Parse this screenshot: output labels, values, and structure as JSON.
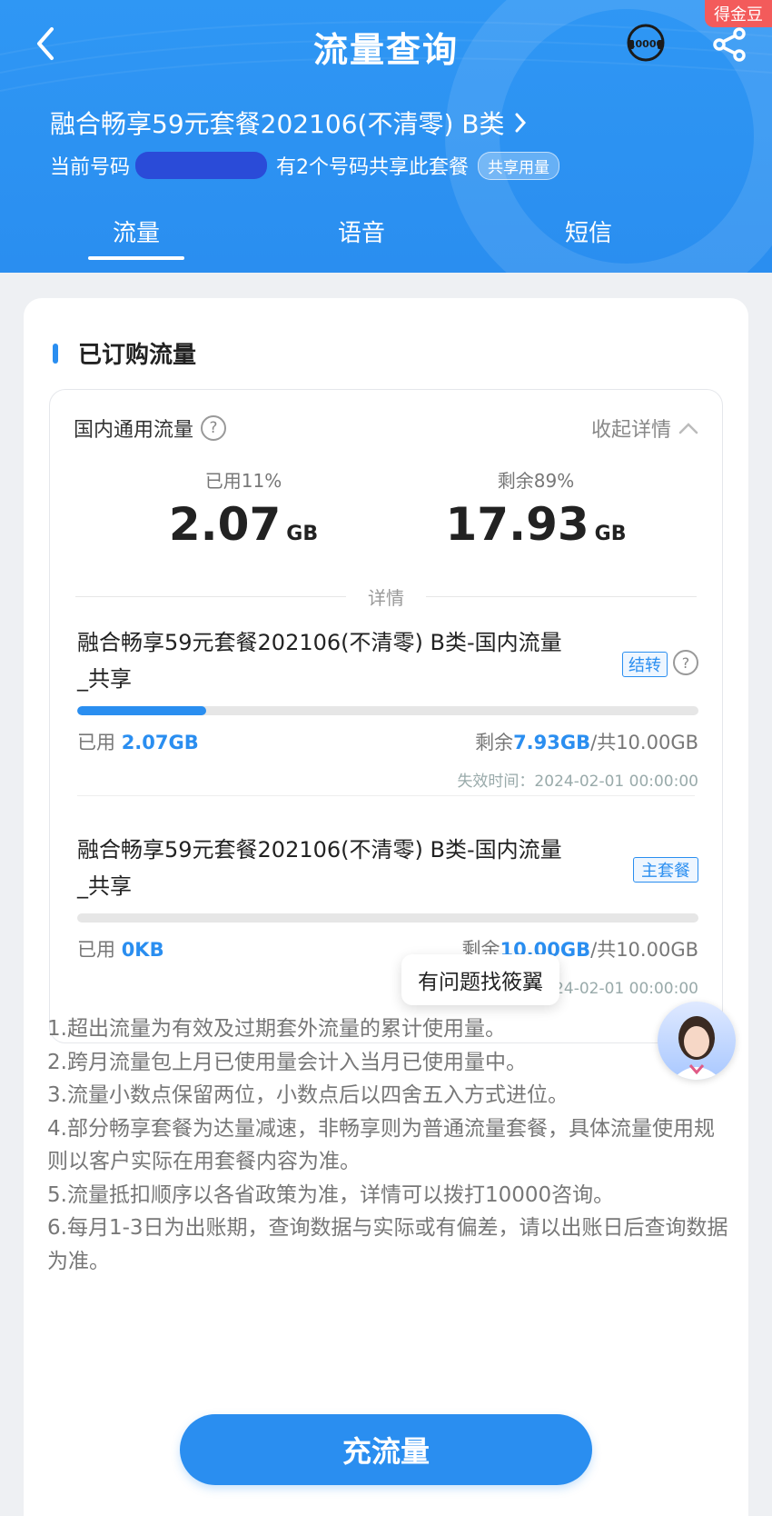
{
  "header": {
    "title": "流量查询",
    "badge_10000": "10000",
    "gold_tag": "得金豆",
    "plan_name": "融合畅享59元套餐202106(不清零) B类",
    "number_prefix": "当前号码",
    "share_count_text": "有2个号码共享此套餐",
    "share_chip": "共享用量",
    "colors": {
      "accent": "#2a8ef0",
      "masked": "#2a4bd8"
    }
  },
  "tabs": [
    {
      "label": "流量",
      "active": true
    },
    {
      "label": "语音",
      "active": false
    },
    {
      "label": "短信",
      "active": false
    }
  ],
  "section": {
    "title": "已订购流量",
    "category_label": "国内通用流量",
    "collapse_label": "收起详情",
    "used": {
      "caption": "已用11%",
      "value": "2.07",
      "unit": "GB"
    },
    "remaining": {
      "caption": "剩余89%",
      "value": "17.93",
      "unit": "GB"
    },
    "detail_label": "详情"
  },
  "items": [
    {
      "name": "融合畅享59元套餐202106(不清零) B类-国内流量_共享",
      "tag": "结转",
      "used_prefix": "已用 ",
      "used_value": "2.07GB",
      "remain_prefix": "剩余",
      "remain_value": "7.93GB",
      "total_text": "/共10.00GB",
      "progress": 0.207,
      "expire": "失效时间：2024-02-01 00:00:00"
    },
    {
      "name": "融合畅享59元套餐202106(不清零) B类-国内流量_共享",
      "tag": "主套餐",
      "used_prefix": "已用 ",
      "used_value": "0KB",
      "remain_prefix": "剩余",
      "remain_value": "10.00GB",
      "total_text": "/共10.00GB",
      "progress": 0.0,
      "expire": "失效时间：2024-02-01 00:00:00"
    }
  ],
  "assistant_tip": "有问题找筱翼",
  "notes": [
    "1.超出流量为有效及过期套外流量的累计使用量。",
    "2.跨月流量包上月已使用量会计入当月已使用量中。",
    "3.流量小数点保留两位，小数点后以四舍五入方式进位。",
    "4.部分畅享套餐为达量减速，非畅享则为普通流量套餐，具体流量使用规则以客户实际在用套餐内容为准。",
    "5.流量抵扣顺序以各省政策为准，详情可以拨打10000咨询。",
    "6.每月1-3日为出账期，查询数据与实际或有偏差，请以出账日后查询数据为准。"
  ],
  "cta": {
    "label": "充流量"
  }
}
